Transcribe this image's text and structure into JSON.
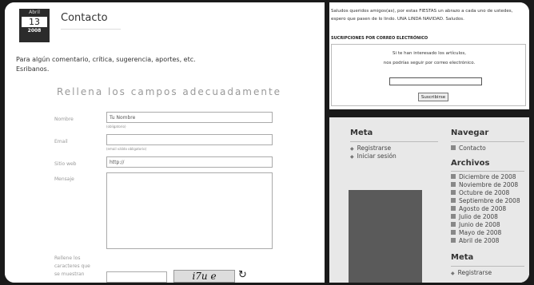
{
  "post": {
    "date": {
      "month": "Abril",
      "day": "13",
      "year": "2008"
    },
    "title": "Contacto",
    "intro_line1": "Para algún comentario, crítica, sugerencia, aportes, etc.",
    "intro_line2": "Esribanos."
  },
  "form": {
    "title": "Rellena los campos adecuadamente",
    "name_label": "Nombre",
    "name_value": "Tu Nombre",
    "name_hint": "(obligatorio)",
    "email_label": "Email",
    "email_value": "",
    "email_hint": "(email válido obligatorio)",
    "web_label": "Sitio web",
    "web_value": "http://",
    "message_label": "Mensaje",
    "captcha_label_1": "Rellene los",
    "captcha_label_2": "caracteres que",
    "captcha_label_3": "se muestran",
    "captcha_text": "i7u e",
    "refresh_icon": "refresh-icon"
  },
  "right": {
    "greeting": "Saludos queridos amigos(as), por estas FIESTAS un abrazo a cada uno de ustedes, espero que pasen de lo lindo. UNA LINDA NAVIDAD. Saludos.",
    "subs_heading": "SUCRIPCIONES POR CORREO ELECTRÓNICO",
    "subs_text1": "Si te han interesado los artículos,",
    "subs_text2": "nos podrías seguir por correo electrónico.",
    "subs_button": "Suscribirse"
  },
  "sidebar": {
    "meta_heading": "Meta",
    "meta_items": [
      "Registrarse",
      "Iniciar sesión"
    ],
    "nav_heading": "Navegar",
    "nav_items": [
      "Contacto"
    ],
    "archives_heading": "Archivos",
    "archives": [
      "Diciembre de 2008",
      "Noviembre de 2008",
      "Octubre de 2008",
      "Septiembre de 2008",
      "Agosto de 2008",
      "Julio de 2008",
      "Junio de 2008",
      "Mayo de 2008",
      "Abril de 2008"
    ],
    "meta2_heading": "Meta",
    "meta2_items": [
      "Registrarse"
    ]
  }
}
